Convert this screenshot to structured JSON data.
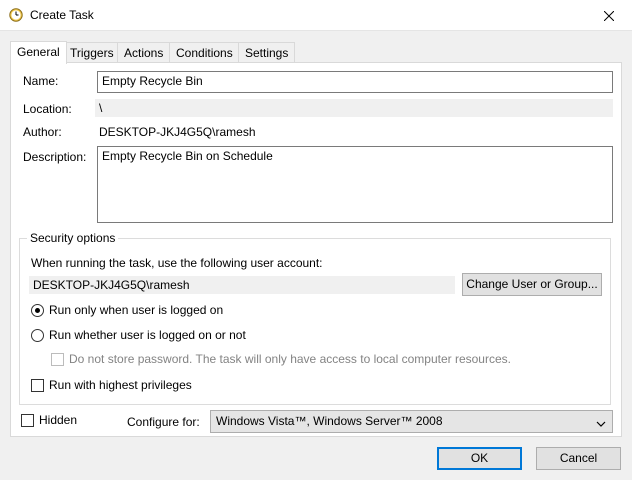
{
  "window": {
    "title": "Create Task",
    "icon": "clock-icon",
    "close_icon": "close-icon"
  },
  "tabs": [
    {
      "label": "General",
      "active": true
    },
    {
      "label": "Triggers",
      "active": false
    },
    {
      "label": "Actions",
      "active": false
    },
    {
      "label": "Conditions",
      "active": false
    },
    {
      "label": "Settings",
      "active": false
    }
  ],
  "general": {
    "name_label": "Name:",
    "name_value": "Empty Recycle Bin",
    "location_label": "Location:",
    "location_value": "\\",
    "author_label": "Author:",
    "author_value": "DESKTOP-JKJ4G5Q\\ramesh",
    "description_label": "Description:",
    "description_value": "Empty Recycle Bin on Schedule"
  },
  "security": {
    "title": "Security options",
    "account_prompt": "When running the task, use the following user account:",
    "account_value": "DESKTOP-JKJ4G5Q\\ramesh",
    "change_button": "Change User or Group...",
    "radio_logged_on": "Run only when user is logged on",
    "radio_logged_on_selected": true,
    "radio_whether": "Run whether user is logged on or not",
    "radio_whether_selected": false,
    "no_store_password": "Do not store password.  The task will only have access to local computer resources.",
    "highest_privileges": "Run with highest privileges"
  },
  "bottom": {
    "hidden_label": "Hidden",
    "configure_label": "Configure for:",
    "configure_value": "Windows Vista™, Windows Server™ 2008"
  },
  "footer": {
    "ok": "OK",
    "cancel": "Cancel"
  },
  "colors": {
    "accent": "#0078d7",
    "dialog_bg": "#f0f0f0",
    "panel_bg": "#ffffff"
  }
}
